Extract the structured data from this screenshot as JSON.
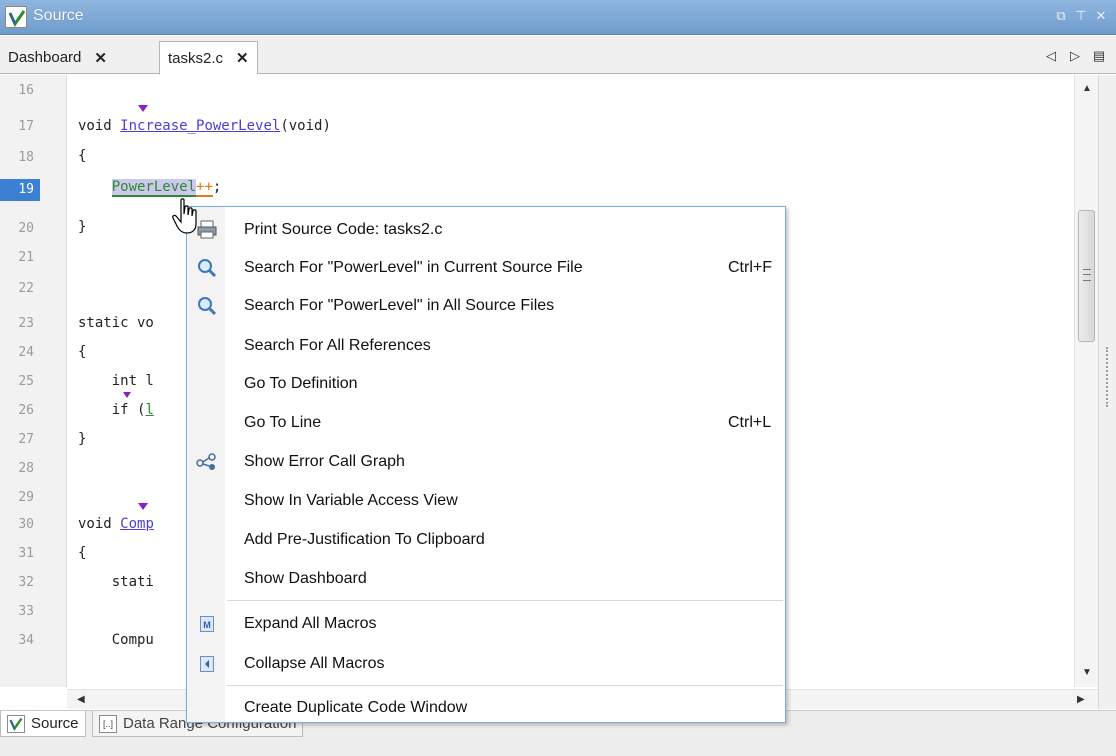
{
  "window": {
    "title": "Source",
    "controls": [
      "restore-icon",
      "pin-icon",
      "close-icon"
    ]
  },
  "tabs": [
    {
      "label": "Dashboard",
      "close": "✕"
    },
    {
      "label": "tasks2.c",
      "close": "✕",
      "active": true
    }
  ],
  "tab_nav": [
    "◁",
    "▷",
    "▤"
  ],
  "editor": {
    "selected_line": 19,
    "lines": [
      {
        "n": "16",
        "text": ""
      },
      {
        "n": "17",
        "text": "void Increase_PowerLevel(void)"
      },
      {
        "n": "18",
        "text": "{"
      },
      {
        "n": "19",
        "text": "    PowerLevel++;"
      },
      {
        "n": "20",
        "text": "}"
      },
      {
        "n": "21",
        "text": ""
      },
      {
        "n": "22",
        "text": ""
      },
      {
        "n": "23",
        "text": "static vo"
      },
      {
        "n": "24",
        "text": "{"
      },
      {
        "n": "25",
        "text": "    int l"
      },
      {
        "n": "26",
        "text": "    if (l"
      },
      {
        "n": "27",
        "text": "}"
      },
      {
        "n": "28",
        "text": ""
      },
      {
        "n": "29",
        "text": ""
      },
      {
        "n": "30",
        "text": "void Comp"
      },
      {
        "n": "31",
        "text": "{"
      },
      {
        "n": "32",
        "text": "    stati"
      },
      {
        "n": "33",
        "text": ""
      },
      {
        "n": "34",
        "text": "    Compu"
      }
    ],
    "code_parts": {
      "void_kw": "void ",
      "fn_name": "Increase_PowerLevel",
      "fn_args": "(void)",
      "indent": "    ",
      "var": "PowerLevel",
      "op": "++",
      "semi": ";",
      "static_vo": "static vo",
      "int_l": "int l",
      "if_kw": "if (",
      "if_var": "l",
      "void_comp_kw": "void ",
      "comp": "Comp",
      "stati": "stati",
      "compu": "Compu",
      "brace_open": "{",
      "brace_close": "}"
    }
  },
  "context_menu": {
    "items": [
      {
        "label": "Print Source Code: tasks2.c",
        "icon": "print-icon"
      },
      {
        "label": "Search For \"PowerLevel\" in Current Source File",
        "shortcut": "Ctrl+F",
        "icon": "search-icon"
      },
      {
        "label": "Search For \"PowerLevel\" in All Source Files",
        "icon": "search-icon"
      },
      {
        "label": "Search For All References"
      },
      {
        "label": "Go To Definition"
      },
      {
        "label": "Go To Line",
        "shortcut": "Ctrl+L"
      },
      {
        "label": "Show Error Call Graph",
        "icon": "call-graph-icon"
      },
      {
        "label": "Show In Variable Access View"
      },
      {
        "label": "Add Pre-Justification To Clipboard"
      },
      {
        "label": "Show Dashboard"
      },
      {
        "label": "Expand All Macros",
        "icon": "expand-macro-icon"
      },
      {
        "label": "Collapse All Macros",
        "icon": "collapse-macro-icon"
      },
      {
        "label": "Create Duplicate Code Window"
      }
    ]
  },
  "bottom_tabs": [
    {
      "label": "Source",
      "icon": "source-check-icon"
    },
    {
      "label": "Data Range Configuration",
      "icon": "bracket-icon",
      "icon_text": "[..]"
    }
  ],
  "colors": {
    "titlebar": "#7fa9d6",
    "selected_line": "#3b80d3",
    "function": "#4b3fd8",
    "variable": "#2c8a2c",
    "operator": "#e07a12",
    "marker": "#8a1ecf"
  }
}
